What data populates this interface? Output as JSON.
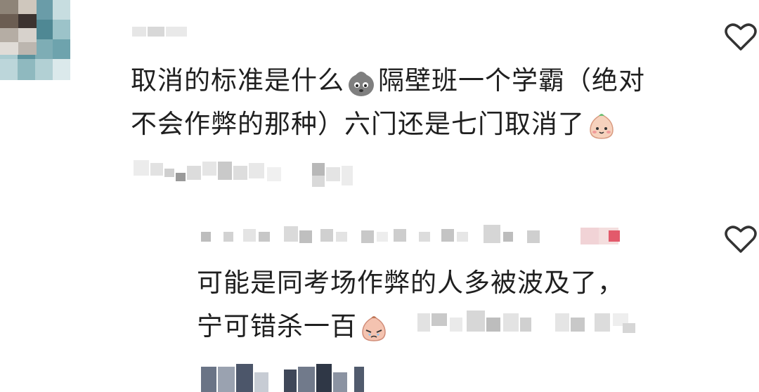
{
  "comments": [
    {
      "text_line1": "取消的标准是什么",
      "text_line1b": "隔壁班一个学霸（绝对",
      "text_line2": "不会作弊的那种）六门还是七门取消了",
      "emoji_1": "sad-ghost-emoji",
      "emoji_2": "smiling-peach-emoji",
      "like_icon": "heart-outline-icon"
    },
    {
      "text_line1": "可能是同考场作弊的人多被波及了，",
      "text_line2": "宁可错杀一百",
      "emoji_1": "crying-peach-emoji",
      "like_icon": "heart-outline-icon"
    }
  ],
  "colors": {
    "text": "#1f1f1f",
    "icon": "#333333",
    "emoji_peach": "#f3c3a8",
    "emoji_gray": "#8a8a8a",
    "mosaic_pink": "#e35a6b"
  }
}
